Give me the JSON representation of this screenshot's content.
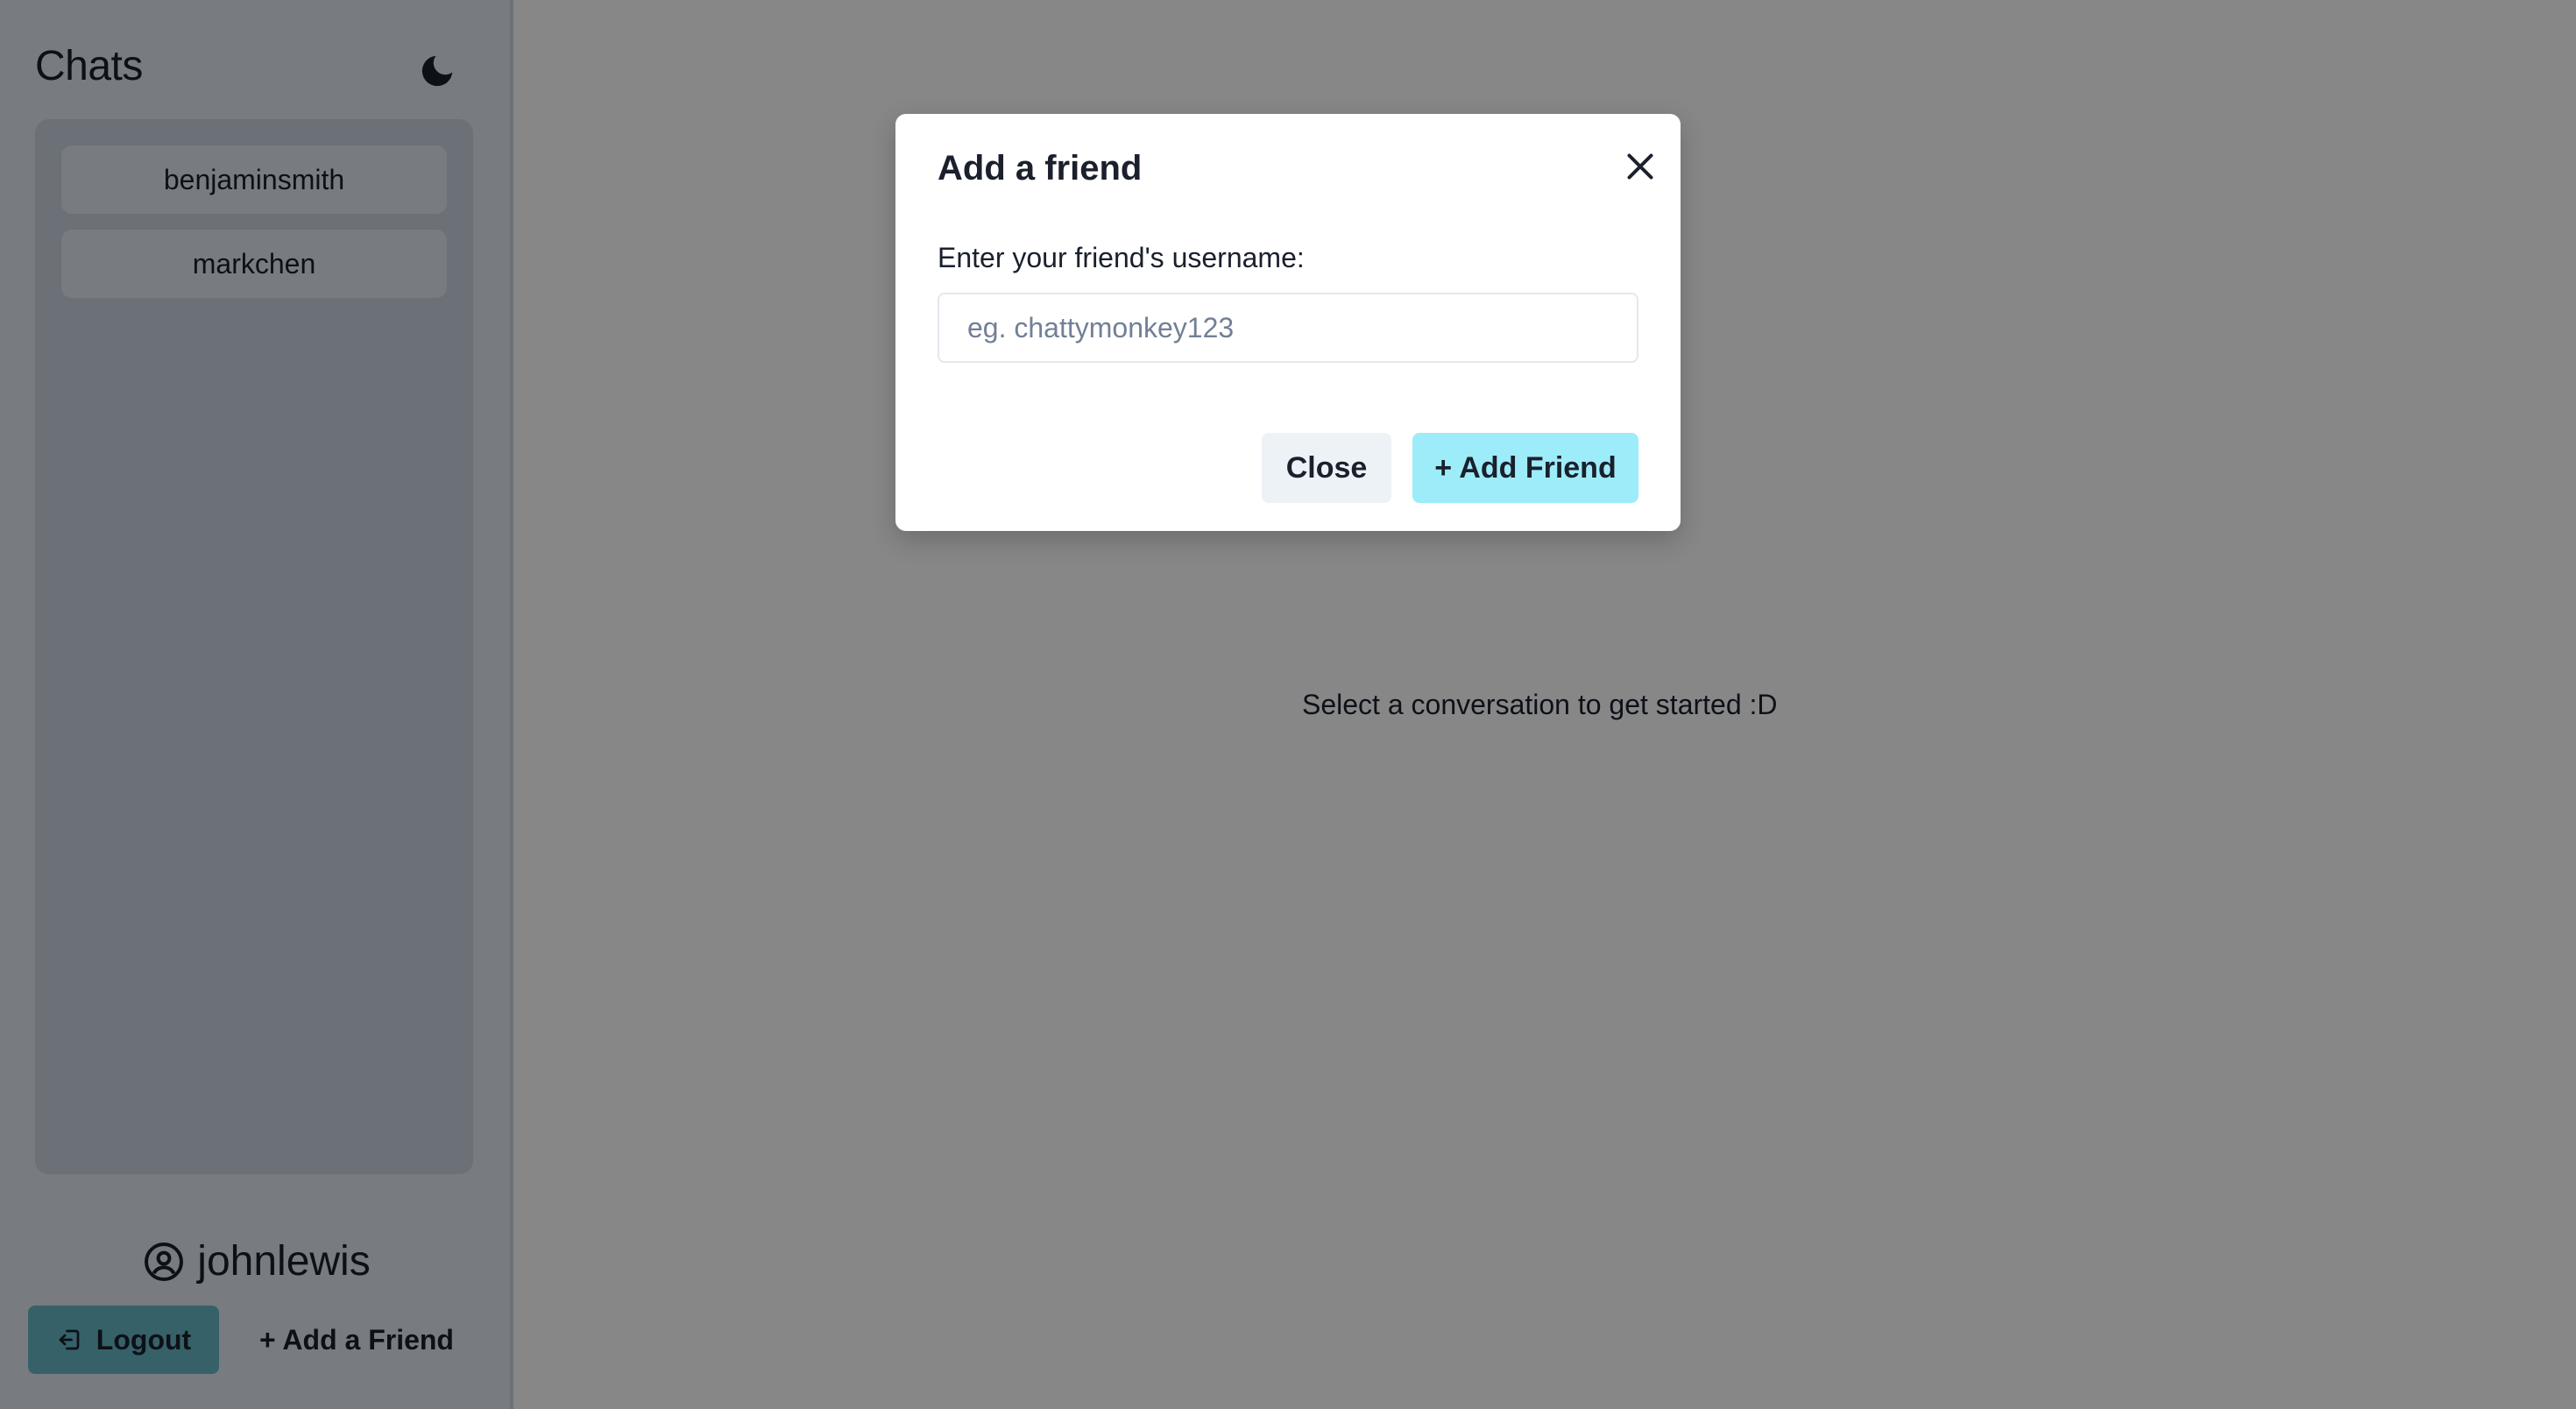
{
  "sidebar": {
    "title": "Chats",
    "theme_toggle_icon": "moon-icon",
    "chats": [
      {
        "label": "benjaminsmith"
      },
      {
        "label": "markchen"
      }
    ],
    "user": {
      "username": "johnlewis",
      "icon": "user-circle-icon"
    },
    "logout_label": "Logout",
    "add_friend_label": "+ Add a Friend"
  },
  "main": {
    "empty_state": "Select a conversation to get started :D"
  },
  "modal": {
    "title": "Add a friend",
    "label": "Enter your friend's username:",
    "input_value": "",
    "input_placeholder": "eg. chattymonkey123",
    "close_label": "Close",
    "add_label": "+ Add Friend"
  },
  "colors": {
    "logout_button": "#67b8c6",
    "add_friend_button": "#9decf9",
    "overlay": "rgba(0,0,0,0.47)"
  }
}
